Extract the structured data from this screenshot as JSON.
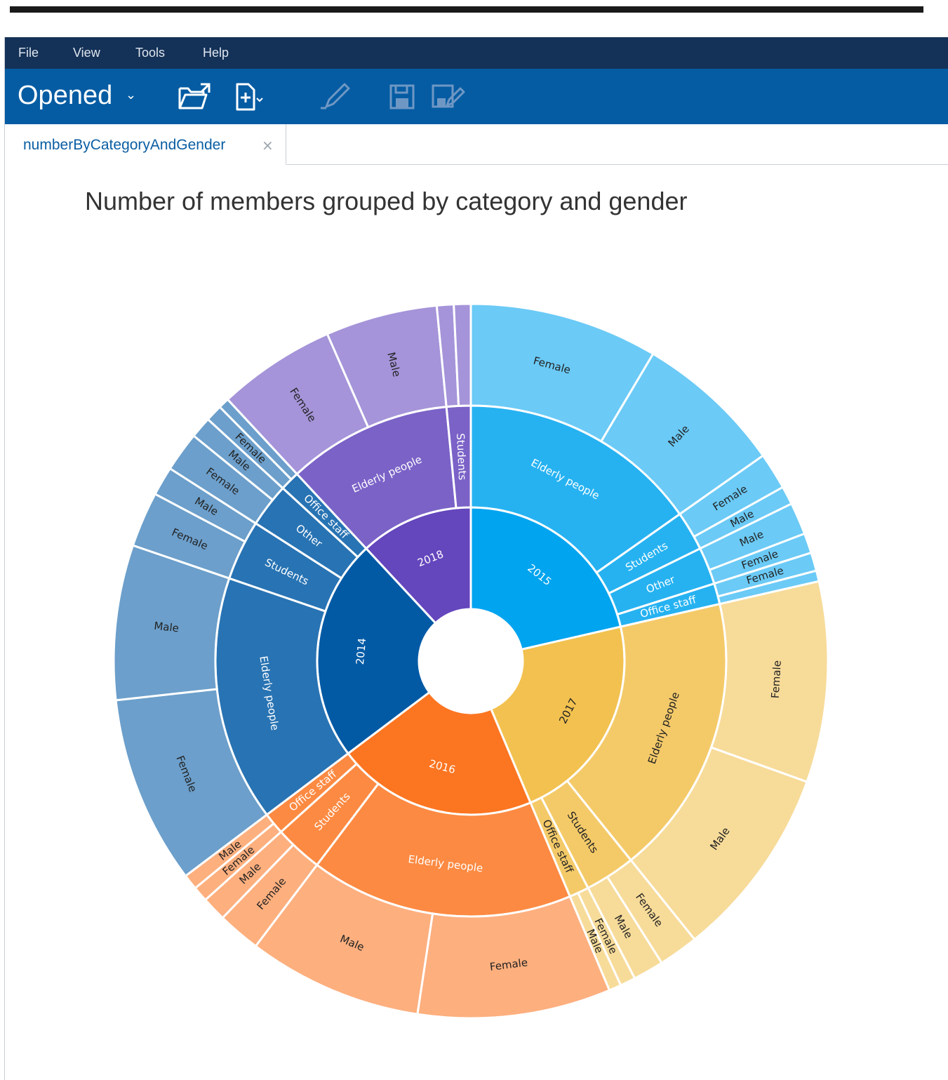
{
  "menu": {
    "items": [
      {
        "label": "File"
      },
      {
        "label": "View"
      },
      {
        "label": "Tools"
      },
      {
        "label": "Help"
      }
    ]
  },
  "toolbar": {
    "opened_label": "Opened",
    "icons": [
      "open-folder-icon",
      "new-document-icon",
      "edit-pencil-icon",
      "save-icon",
      "save-as-icon"
    ]
  },
  "tab": {
    "label": "numberByCategoryAndGender",
    "close": "×"
  },
  "colors": {
    "menubar": "#143157",
    "toolbar": "#055ca3",
    "tab_text": "#0b5ea3"
  },
  "chart_data": {
    "type": "sunburst",
    "title": "Number of members grouped by category and gender",
    "levels": [
      "year",
      "category",
      "gender"
    ],
    "rings": [
      {
        "name": "2015",
        "color": "#00a4ef",
        "children": [
          {
            "name": "Elderly people",
            "children": [
              {
                "name": "Female",
                "value": 123
              },
              {
                "name": "Male",
                "value": 97
              }
            ]
          },
          {
            "name": "Students",
            "children": [
              {
                "name": "Female",
                "value": 24
              },
              {
                "name": "Male",
                "value": 12
              }
            ]
          },
          {
            "name": "Other",
            "children": [
              {
                "name": "Male",
                "value": 21
              },
              {
                "name": "Female",
                "value": 13
              }
            ]
          },
          {
            "name": "Office staff",
            "children": [
              {
                "name": "Female",
                "value": 12
              },
              {
                "name": "",
                "value": 7
              }
            ]
          }
        ]
      },
      {
        "name": "2017",
        "color": "#f2c14f",
        "children": [
          {
            "name": "Elderly people",
            "children": [
              {
                "name": "Female",
                "value": 131
              },
              {
                "name": "Male",
                "value": 126
              }
            ]
          },
          {
            "name": "Students",
            "children": [
              {
                "name": "Female",
                "value": 26
              },
              {
                "name": "Male",
                "value": 20
              }
            ]
          },
          {
            "name": "Office staff",
            "children": [
              {
                "name": "Female",
                "value": 10
              },
              {
                "name": "Male",
                "value": 8
              }
            ]
          }
        ]
      },
      {
        "name": "2016",
        "color": "#fc7521",
        "children": [
          {
            "name": "Elderly people",
            "children": [
              {
                "name": "Female",
                "value": 126
              },
              {
                "name": "Male",
                "value": 114
              }
            ]
          },
          {
            "name": "Students",
            "children": [
              {
                "name": "Female",
                "value": 28
              },
              {
                "name": "Male",
                "value": 16
              }
            ]
          },
          {
            "name": "Office staff",
            "children": [
              {
                "name": "Female",
                "value": 10
              },
              {
                "name": "Male",
                "value": 10
              }
            ]
          }
        ]
      },
      {
        "name": "2014",
        "color": "#025aa5",
        "children": [
          {
            "name": "Elderly people",
            "children": [
              {
                "name": "Female",
                "value": 123
              },
              {
                "name": "Male",
                "value": 101
              }
            ]
          },
          {
            "name": "Students",
            "children": [
              {
                "name": "Female",
                "value": 36
              },
              {
                "name": "Male",
                "value": 19
              }
            ]
          },
          {
            "name": "Other",
            "children": [
              {
                "name": "Female",
                "value": 26
              },
              {
                "name": "Male",
                "value": 14
              }
            ]
          },
          {
            "name": "Office staff",
            "children": [
              {
                "name": "Female",
                "value": 11
              },
              {
                "name": "",
                "value": 7
              }
            ]
          }
        ]
      },
      {
        "name": "2018",
        "color": "#6446bd",
        "children": [
          {
            "name": "Elderly people",
            "children": [
              {
                "name": "Female",
                "value": 77
              },
              {
                "name": "Male",
                "value": 73
              }
            ]
          },
          {
            "name": "Students",
            "children": [
              {
                "name": "",
                "value": 11
              },
              {
                "name": "",
                "value": 11
              }
            ]
          }
        ]
      }
    ]
  }
}
